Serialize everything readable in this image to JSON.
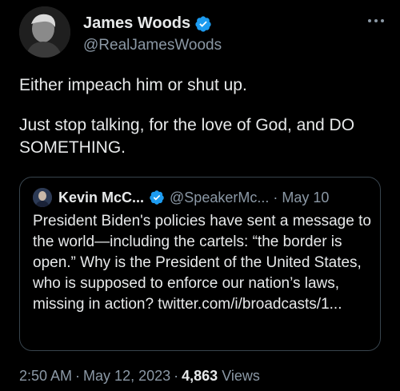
{
  "author": {
    "name": "James Woods",
    "handle": "@RealJamesWoods"
  },
  "tweet": {
    "paragraphs": [
      "Either impeach him or shut up.",
      "Just stop talking, for the love of God, and DO SOMETHING."
    ]
  },
  "quote": {
    "name": "Kevin McC...",
    "handle": "@SpeakerMc...",
    "dot": "·",
    "date": "May 10",
    "text": "President Biden's policies have sent a message to the world—including the cartels: “the border is open.”  Why is the President of the United States, who is supposed to enforce our nation’s laws, missing in action? twitter.com/i/broadcasts/1..."
  },
  "meta": {
    "time": "2:50 AM",
    "sep1": "·",
    "date": "May 12, 2023",
    "sep2": "·",
    "views_count": "4,863",
    "views_label": "Views"
  },
  "colors": {
    "background": "#000000",
    "text": "#e7e9ea",
    "secondary": "#8b98a5",
    "verified": "#1d9bf0",
    "border": "#38444d"
  },
  "icons": [
    "verified-badge-icon",
    "more-options-icon"
  ]
}
